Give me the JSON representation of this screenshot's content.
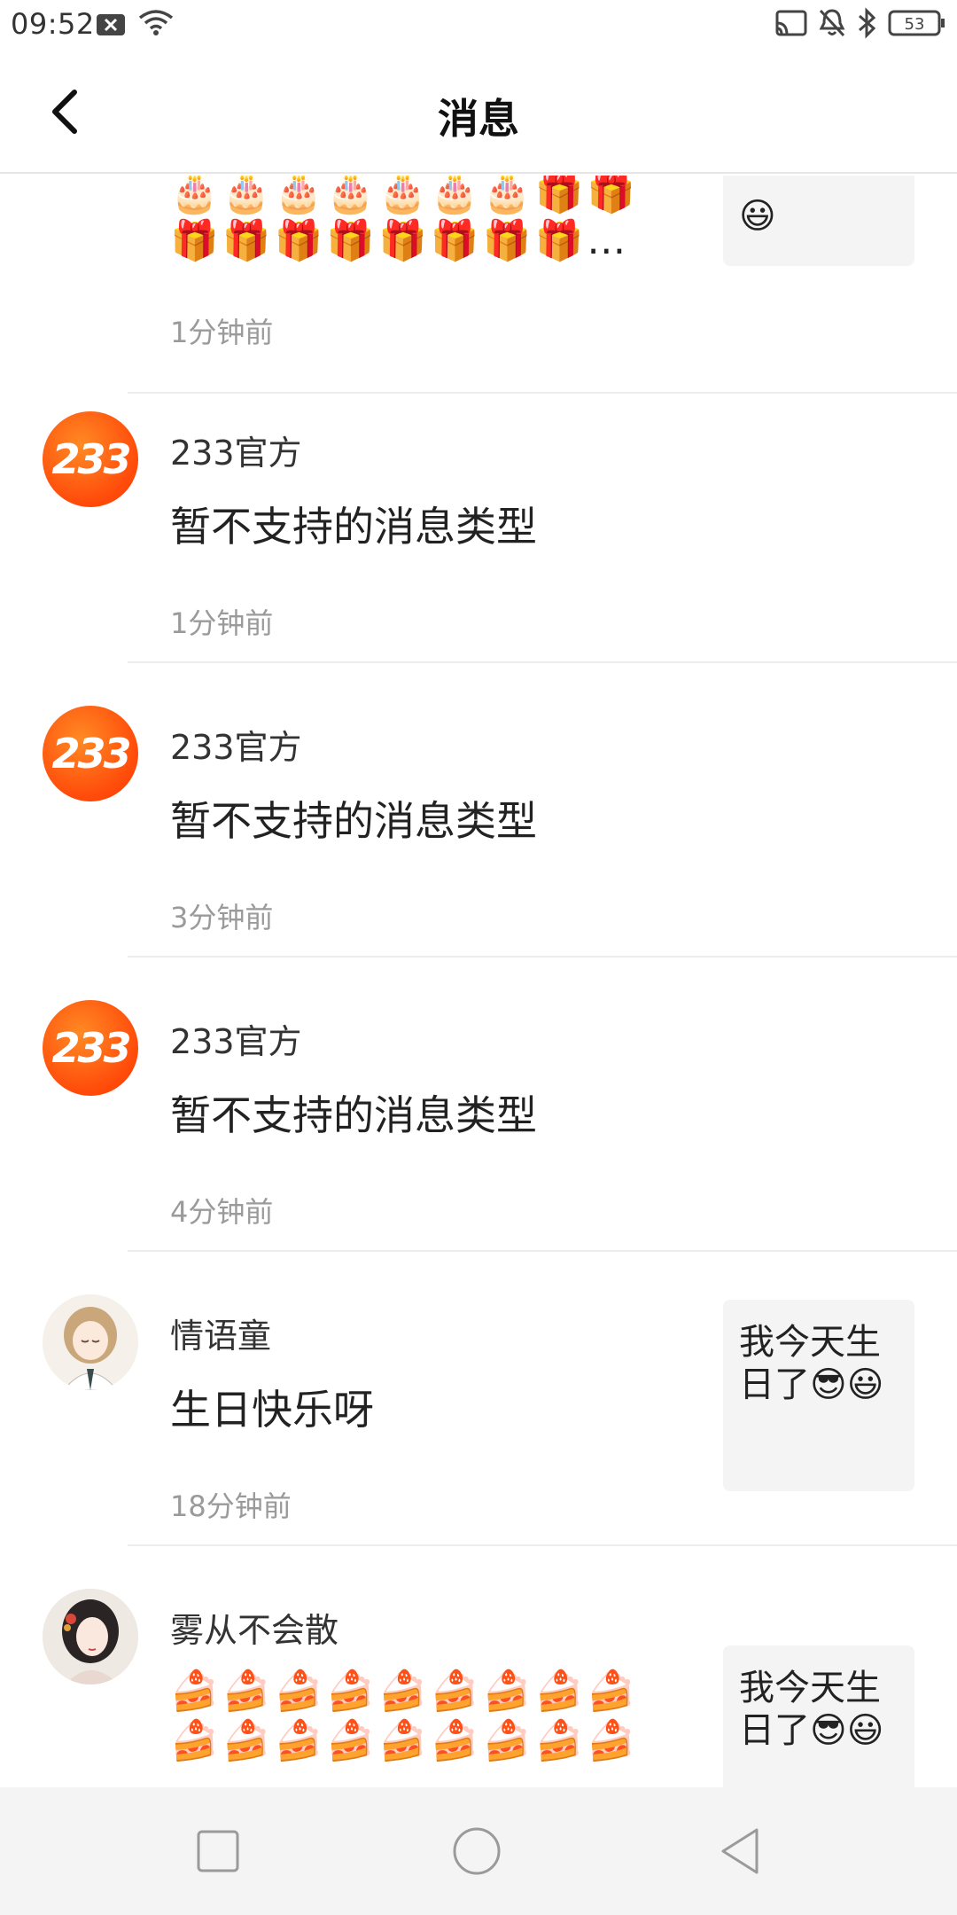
{
  "status_bar": {
    "time": "09:52",
    "battery": "53",
    "icons": [
      "notification-x-icon",
      "wifi-icon",
      "cast-icon",
      "mute-icon",
      "bluetooth-icon",
      "battery-icon"
    ]
  },
  "header": {
    "title": "消息"
  },
  "messages": [
    {
      "content": "🎂🎂🎂🎂🎂🎂🎂🎁🎁",
      "content2": "🎁🎁🎁🎁🎁🎁🎁🎁…",
      "time": "1分钟前",
      "preview_tail": "😃"
    },
    {
      "name": "233官方",
      "avatar_text": "233",
      "content": "暂不支持的消息类型",
      "time": "1分钟前"
    },
    {
      "name": "233官方",
      "avatar_text": "233",
      "content": "暂不支持的消息类型",
      "time": "3分钟前"
    },
    {
      "name": "233官方",
      "avatar_text": "233",
      "content": "暂不支持的消息类型",
      "time": "4分钟前"
    },
    {
      "name": "情语童",
      "content": "生日快乐呀",
      "time": "18分钟前",
      "preview": "我今天生日了😎😃"
    },
    {
      "name": "雾从不会散",
      "content": "🍰🍰🍰🍰🍰🍰🍰🍰🍰",
      "content2": "🍰🍰🍰🍰🍰🍰🍰🍰🍰",
      "preview": "我今天生日了😎😃"
    }
  ],
  "colors": {
    "brand_orange": "#ff5a10",
    "divider": "#ececec",
    "time_gray": "#9a9a9a"
  }
}
